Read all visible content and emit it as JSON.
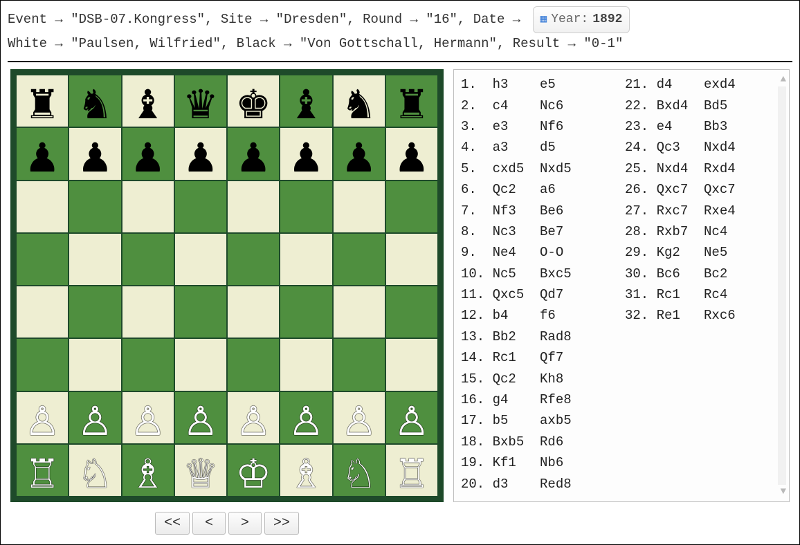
{
  "header": {
    "fields": [
      {
        "key": "Event",
        "value": "\"DSB-07.Kongress\""
      },
      {
        "key": "Site",
        "value": "\"Dresden\""
      },
      {
        "key": "Round",
        "value": "\"16\""
      },
      {
        "key": "Date",
        "value": null
      }
    ],
    "year_badge": {
      "label": "Year:",
      "year": "1892"
    },
    "fields2": [
      {
        "key": "White",
        "value": "\"Paulsen, Wilfried\""
      },
      {
        "key": "Black",
        "value": "\"Von Gottschall, Hermann\""
      },
      {
        "key": "Result",
        "value": "\"0-1\""
      }
    ],
    "arrow": "→"
  },
  "board": {
    "colors": {
      "light": "#eeeed2",
      "dark": "#4f8f3f",
      "border": "#1e4a2a"
    },
    "position_fen": "rnbqkbnr/pppppppp/8/8/8/8/PPPPPPPP/RNBQKBNR",
    "rows": [
      [
        {
          "glyph": "♜",
          "color": "black"
        },
        {
          "glyph": "♞",
          "color": "black"
        },
        {
          "glyph": "♝",
          "color": "black"
        },
        {
          "glyph": "♛",
          "color": "black"
        },
        {
          "glyph": "♚",
          "color": "black"
        },
        {
          "glyph": "♝",
          "color": "black"
        },
        {
          "glyph": "♞",
          "color": "black"
        },
        {
          "glyph": "♜",
          "color": "black"
        }
      ],
      [
        {
          "glyph": "♟",
          "color": "black"
        },
        {
          "glyph": "♟",
          "color": "black"
        },
        {
          "glyph": "♟",
          "color": "black"
        },
        {
          "glyph": "♟",
          "color": "black"
        },
        {
          "glyph": "♟",
          "color": "black"
        },
        {
          "glyph": "♟",
          "color": "black"
        },
        {
          "glyph": "♟",
          "color": "black"
        },
        {
          "glyph": "♟",
          "color": "black"
        }
      ],
      [
        null,
        null,
        null,
        null,
        null,
        null,
        null,
        null
      ],
      [
        null,
        null,
        null,
        null,
        null,
        null,
        null,
        null
      ],
      [
        null,
        null,
        null,
        null,
        null,
        null,
        null,
        null
      ],
      [
        null,
        null,
        null,
        null,
        null,
        null,
        null,
        null
      ],
      [
        {
          "glyph": "♙",
          "color": "white"
        },
        {
          "glyph": "♙",
          "color": "white"
        },
        {
          "glyph": "♙",
          "color": "white"
        },
        {
          "glyph": "♙",
          "color": "white"
        },
        {
          "glyph": "♙",
          "color": "white"
        },
        {
          "glyph": "♙",
          "color": "white"
        },
        {
          "glyph": "♙",
          "color": "white"
        },
        {
          "glyph": "♙",
          "color": "white"
        }
      ],
      [
        {
          "glyph": "♖",
          "color": "white"
        },
        {
          "glyph": "♘",
          "color": "white"
        },
        {
          "glyph": "♗",
          "color": "white"
        },
        {
          "glyph": "♕",
          "color": "white"
        },
        {
          "glyph": "♔",
          "color": "white"
        },
        {
          "glyph": "♗",
          "color": "white"
        },
        {
          "glyph": "♘",
          "color": "white"
        },
        {
          "glyph": "♖",
          "color": "white"
        }
      ]
    ]
  },
  "nav": {
    "first": "<<",
    "prev": "<",
    "next": ">",
    "last": ">>"
  },
  "moves": [
    {
      "n": 1,
      "w": "h3",
      "b": "e5"
    },
    {
      "n": 2,
      "w": "c4",
      "b": "Nc6"
    },
    {
      "n": 3,
      "w": "e3",
      "b": "Nf6"
    },
    {
      "n": 4,
      "w": "a3",
      "b": "d5"
    },
    {
      "n": 5,
      "w": "cxd5",
      "b": "Nxd5"
    },
    {
      "n": 6,
      "w": "Qc2",
      "b": "a6"
    },
    {
      "n": 7,
      "w": "Nf3",
      "b": "Be6"
    },
    {
      "n": 8,
      "w": "Nc3",
      "b": "Be7"
    },
    {
      "n": 9,
      "w": "Ne4",
      "b": "O-O"
    },
    {
      "n": 10,
      "w": "Nc5",
      "b": "Bxc5"
    },
    {
      "n": 11,
      "w": "Qxc5",
      "b": "Qd7"
    },
    {
      "n": 12,
      "w": "b4",
      "b": "f6"
    },
    {
      "n": 13,
      "w": "Bb2",
      "b": "Rad8"
    },
    {
      "n": 14,
      "w": "Rc1",
      "b": "Qf7"
    },
    {
      "n": 15,
      "w": "Qc2",
      "b": "Kh8"
    },
    {
      "n": 16,
      "w": "g4",
      "b": "Rfe8"
    },
    {
      "n": 17,
      "w": "b5",
      "b": "axb5"
    },
    {
      "n": 18,
      "w": "Bxb5",
      "b": "Rd6"
    },
    {
      "n": 19,
      "w": "Kf1",
      "b": "Nb6"
    },
    {
      "n": 20,
      "w": "d3",
      "b": "Red8"
    },
    {
      "n": 21,
      "w": "d4",
      "b": "exd4"
    },
    {
      "n": 22,
      "w": "Bxd4",
      "b": "Bd5"
    },
    {
      "n": 23,
      "w": "e4",
      "b": "Bb3"
    },
    {
      "n": 24,
      "w": "Qc3",
      "b": "Nxd4"
    },
    {
      "n": 25,
      "w": "Nxd4",
      "b": "Rxd4"
    },
    {
      "n": 26,
      "w": "Qxc7",
      "b": "Qxc7"
    },
    {
      "n": 27,
      "w": "Rxc7",
      "b": "Rxe4"
    },
    {
      "n": 28,
      "w": "Rxb7",
      "b": "Nc4"
    },
    {
      "n": 29,
      "w": "Kg2",
      "b": "Ne5"
    },
    {
      "n": 30,
      "w": "Bc6",
      "b": "Bc2"
    },
    {
      "n": 31,
      "w": "Rc1",
      "b": "Rc4"
    },
    {
      "n": 32,
      "w": "Re1",
      "b": "Rxc6"
    }
  ]
}
